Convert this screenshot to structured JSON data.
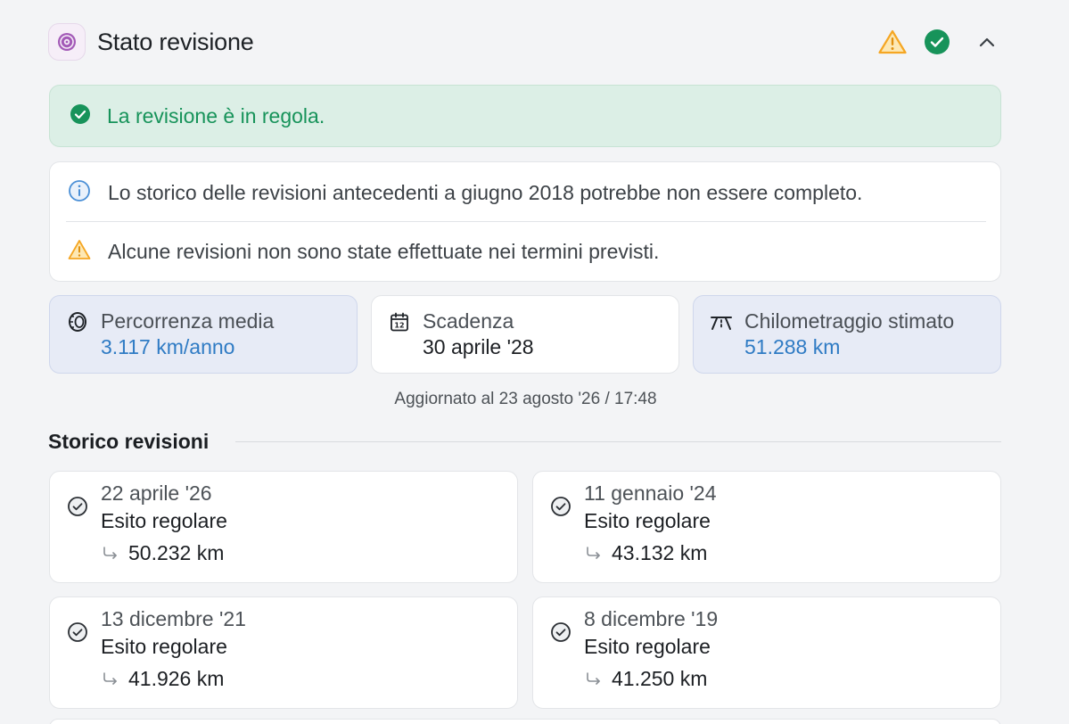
{
  "header": {
    "title": "Stato revisione",
    "logo_icon": "brake-disc-icon",
    "warning_icon": "warning-triangle-icon",
    "ok_icon": "check-circle-icon",
    "collapse_icon": "chevron-up-icon"
  },
  "status_banner": {
    "text": "La revisione è in regola.",
    "color": "#17935a",
    "background": "#dcefe6"
  },
  "notices": [
    {
      "icon": "info-icon",
      "text": "Lo storico delle revisioni antecedenti a giugno 2018 potrebbe non essere completo."
    },
    {
      "icon": "warning-triangle-icon",
      "text": "Alcune revisioni non sono state effettuate nei termini previsti."
    }
  ],
  "stats": [
    {
      "icon": "tire-icon",
      "label": "Percorrenza media",
      "value": "3.117 km/anno"
    },
    {
      "icon": "calendar-icon",
      "label": "Scadenza",
      "value": "30 aprile '28"
    },
    {
      "icon": "road-icon",
      "label": "Chilometraggio stimato",
      "value": "51.288 km"
    }
  ],
  "updated": "Aggiornato al 23 agosto '26 / 17:48",
  "history": {
    "title": "Storico revisioni",
    "items": [
      {
        "date": "22 aprile '26",
        "result": "Esito regolare",
        "km": "50.232 km"
      },
      {
        "date": "11 gennaio '24",
        "result": "Esito regolare",
        "km": "43.132 km"
      },
      {
        "date": "13 dicembre '21",
        "result": "Esito regolare",
        "km": "41.926 km"
      },
      {
        "date": "8 dicembre '19",
        "result": "Esito regolare",
        "km": "41.250 km"
      }
    ]
  },
  "colors": {
    "accent_blue": "#2f7bc4",
    "success_green": "#17935a",
    "warning_amber": "#f5a623"
  }
}
